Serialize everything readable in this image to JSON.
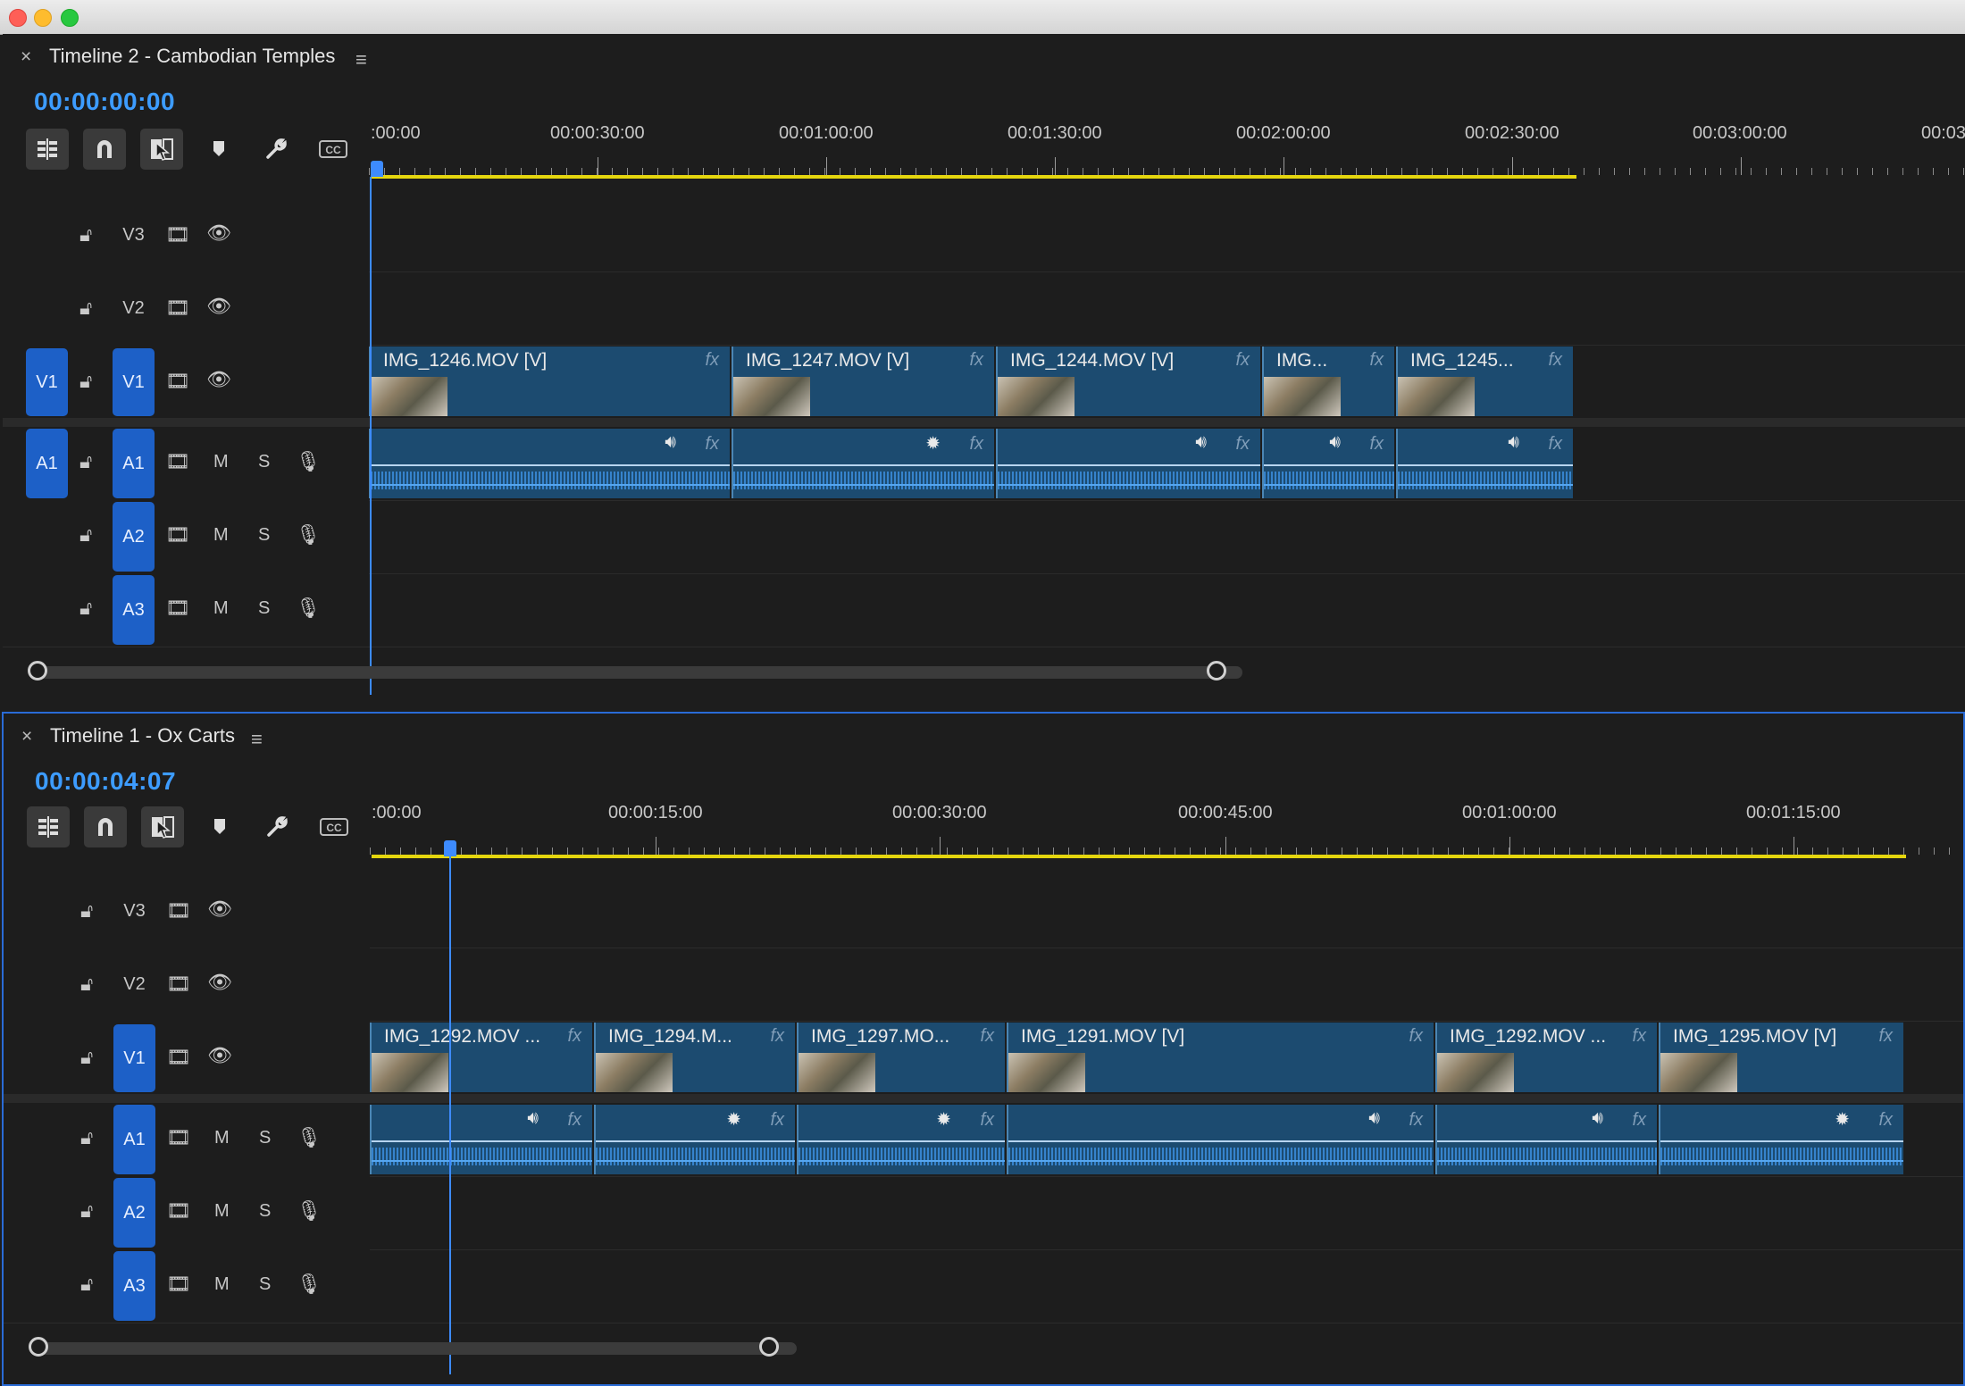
{
  "timelines": [
    {
      "title": "Timeline 2 - Cambodian Temples",
      "timecode": "00:00:00:00",
      "ruler": [
        ":00:00",
        "00:00:30:00",
        "00:01:00:00",
        "00:01:30:00",
        "00:02:00:00",
        "00:02:30:00",
        "00:03:00:00",
        "00:03"
      ],
      "tracks": {
        "v3": "V3",
        "v2": "V2",
        "v1": "V1",
        "a1": "A1",
        "a2": "A2",
        "a3": "A3",
        "source_v": "V1",
        "source_a": "A1",
        "mute": "M",
        "solo": "S"
      },
      "video_clips": [
        "IMG_1246.MOV [V]",
        "IMG_1247.MOV [V]",
        "IMG_1244.MOV [V]",
        "IMG...",
        "IMG_1245..."
      ],
      "fx_label": "fx"
    },
    {
      "title": "Timeline 1 - Ox Carts",
      "timecode": "00:00:04:07",
      "ruler": [
        ":00:00",
        "00:00:15:00",
        "00:00:30:00",
        "00:00:45:00",
        "00:01:00:00",
        "00:01:15:00"
      ],
      "tracks": {
        "v3": "V3",
        "v2": "V2",
        "v1": "V1",
        "a1": "A1",
        "a2": "A2",
        "a3": "A3",
        "mute": "M",
        "solo": "S"
      },
      "video_clips": [
        "IMG_1292.MOV ...",
        "IMG_1294.M...",
        "IMG_1297.MO...",
        "IMG_1291.MOV [V]",
        "IMG_1292.MOV ...",
        "IMG_1295.MOV [V]"
      ],
      "fx_label": "fx"
    }
  ],
  "icons": {
    "close": "×",
    "menu": "≡",
    "lock": "lock-icon",
    "toggle_output": "film-icon",
    "eye": "eye-icon",
    "mic": "mic-icon",
    "speaker": "speaker-icon",
    "burst": "burst-icon"
  },
  "colors": {
    "accent": "#3d9cff",
    "track_target": "#1d60c7",
    "clip": "#1c4b70",
    "work_area": "#e5d60e"
  }
}
